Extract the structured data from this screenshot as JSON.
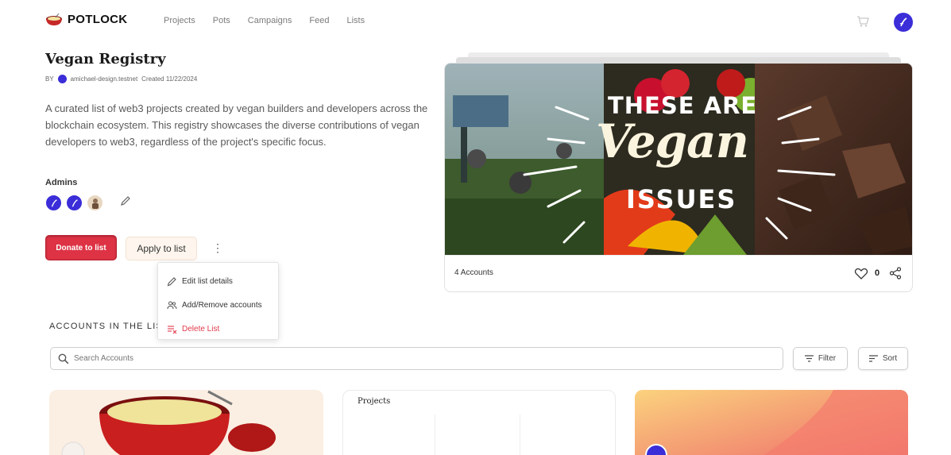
{
  "nav": {
    "brand": "POTLOCK",
    "links": [
      "Projects",
      "Pots",
      "Campaigns",
      "Feed",
      "Lists"
    ]
  },
  "list": {
    "title": "Vegan Registry",
    "by_label": "BY",
    "creator": "amichael-design.testnet",
    "created": "Created 11/22/2024",
    "description": "A curated list of web3 projects created by vegan builders and developers across the blockchain ecosystem. This registry showcases the diverse contributions of vegan developers to web3, regardless of the project's specific focus.",
    "admins_label": "Admins"
  },
  "actions": {
    "donate": "Donate to list",
    "apply": "Apply to list",
    "more": "⋮"
  },
  "menu": {
    "items": [
      "Edit list details",
      "Add/Remove accounts",
      "Delete List"
    ]
  },
  "hero": {
    "line1": "THESE ARE",
    "line2": "Vegan",
    "line3": "ISSUES",
    "accounts": "4 Accounts",
    "likes": "0"
  },
  "accounts_section": {
    "title": "ACCOUNTS IN THE LIST",
    "search_placeholder": "Search Accounts",
    "filter": "Filter",
    "sort": "Sort"
  },
  "cards": {
    "card2_heading": "Projects"
  },
  "colors": {
    "brand_red": "#dd3345",
    "near_blue": "#3b2dd8",
    "danger": "#e2394b"
  }
}
